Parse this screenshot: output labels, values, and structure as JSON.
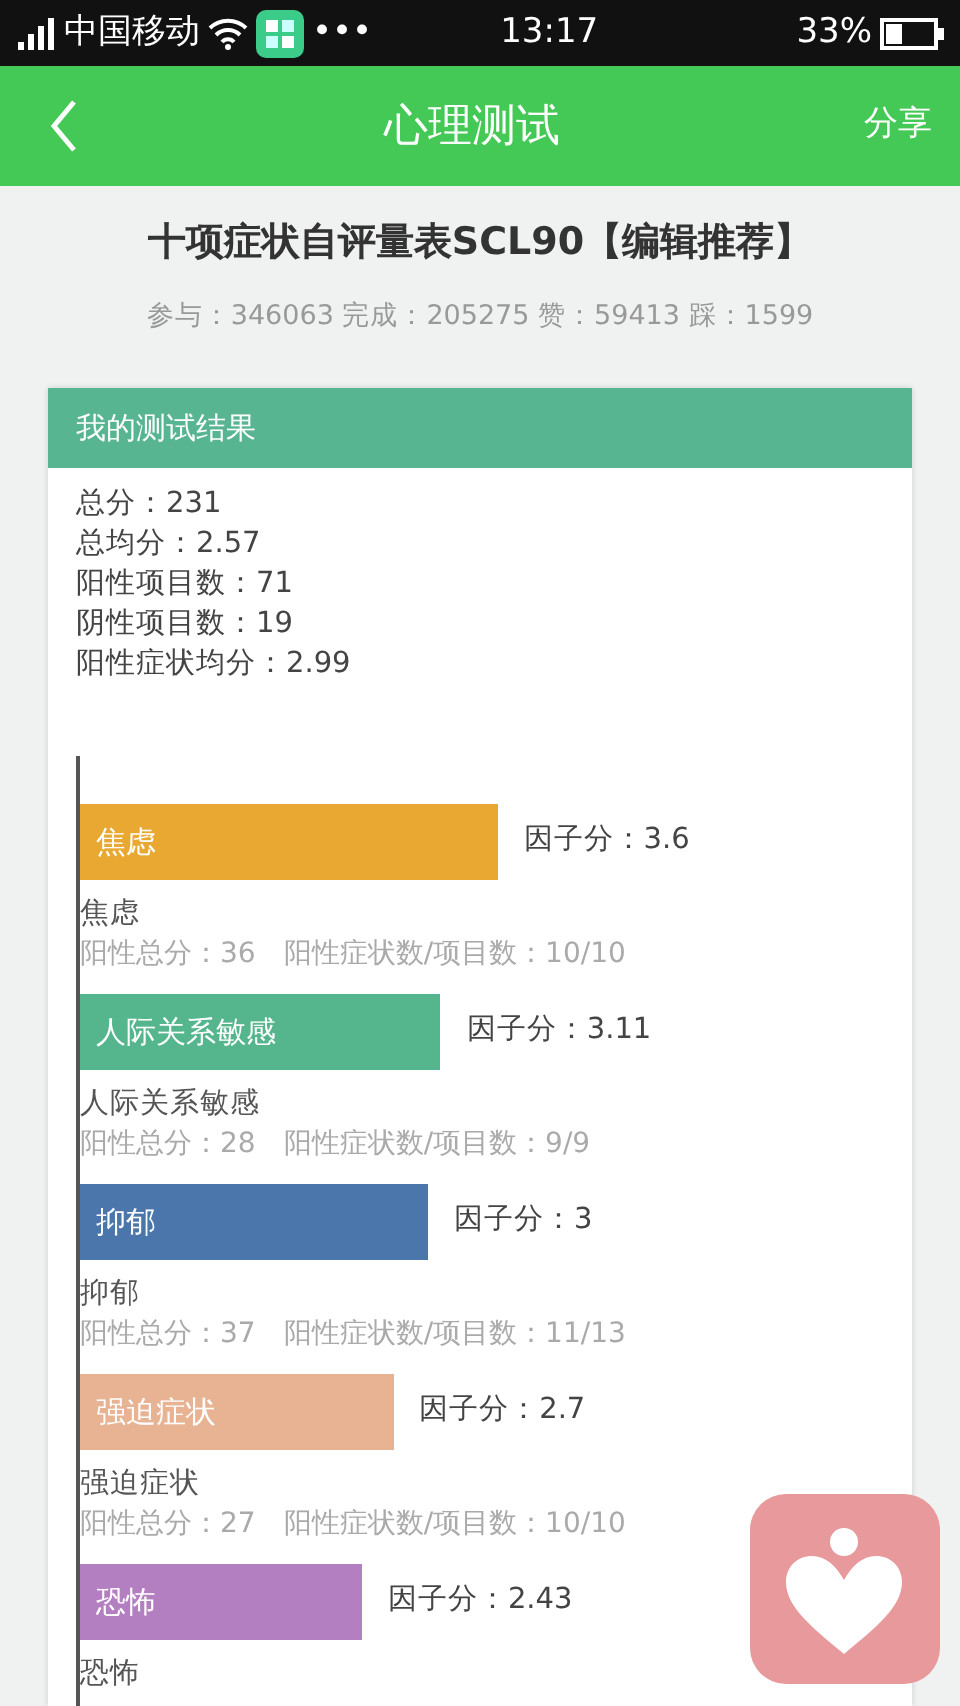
{
  "status_bar": {
    "carrier": "中国移动",
    "more": "•••",
    "time": "13:17",
    "battery_text": "33%"
  },
  "header": {
    "title": "心理测试",
    "action": "分享"
  },
  "test": {
    "title": "十项症状自评量表SCL90【编辑推荐】",
    "stats": "参与：346063 完成：205275 赞：59413 踩：1599"
  },
  "result": {
    "heading": "我的测试结果",
    "summary": [
      "总分：231",
      "总均分：2.57",
      "阳性项目数：71",
      "阴性项目数：19",
      "阳性症状均分：2.99"
    ],
    "factors": [
      {
        "name": "焦虑",
        "score": "因子分：3.6",
        "color": "#e9a832",
        "label": "焦虑",
        "detail": "阳性总分：36　阳性症状数/项目数：10/10"
      },
      {
        "name": "人际关系敏感",
        "score": "因子分：3.11",
        "color": "#55b68e",
        "label": "人际关系敏感",
        "detail": "阳性总分：28　阳性症状数/项目数：9/9"
      },
      {
        "name": "抑郁",
        "score": "因子分：3",
        "color": "#4a76ab",
        "label": "抑郁",
        "detail": "阳性总分：37　阳性症状数/项目数：11/13"
      },
      {
        "name": "强迫症状",
        "score": "因子分：2.7",
        "color": "#e8b393",
        "label": "强迫症状",
        "detail": "阳性总分：27　阳性症状数/项目数：10/10"
      },
      {
        "name": "恐怖",
        "score": "因子分：2.43",
        "color": "#b37fc0",
        "label": "恐怖"
      }
    ]
  }
}
